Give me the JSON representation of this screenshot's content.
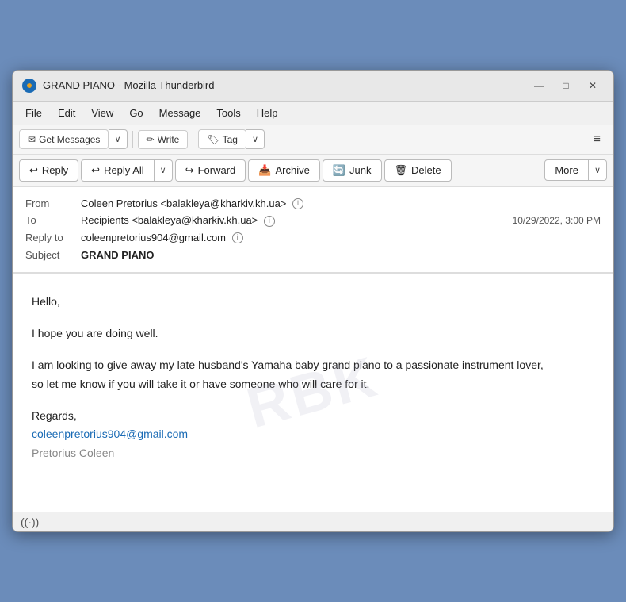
{
  "window": {
    "title": "GRAND PIANO - Mozilla Thunderbird",
    "app_icon": "T",
    "controls": {
      "minimize": "—",
      "maximize": "□",
      "close": "✕"
    }
  },
  "menu_bar": {
    "items": [
      "File",
      "Edit",
      "View",
      "Go",
      "Message",
      "Tools",
      "Help"
    ]
  },
  "toolbar": {
    "get_messages_label": "Get Messages",
    "write_label": "Write",
    "tag_label": "Tag",
    "dropdown_arrow": "∨",
    "hamburger": "≡"
  },
  "action_bar": {
    "reply_label": "Reply",
    "reply_all_label": "Reply All",
    "forward_label": "Forward",
    "archive_label": "Archive",
    "junk_label": "Junk",
    "delete_label": "Delete",
    "more_label": "More",
    "dropdown_arrow": "∨"
  },
  "email_header": {
    "from_label": "From",
    "from_name": "Coleen Pretorius",
    "from_email": "<balakleya@kharkiv.kh.ua>",
    "to_label": "To",
    "to_name": "Recipients",
    "to_email": "<balakleya@kharkiv.kh.ua>",
    "date": "10/29/2022, 3:00 PM",
    "reply_to_label": "Reply to",
    "reply_to_email": "coleenpretorius904@gmail.com",
    "subject_label": "Subject",
    "subject_value": "GRAND PIANO"
  },
  "email_body": {
    "greeting": "Hello,",
    "line1": "I hope you are doing well.",
    "line2": "I am looking to give away my late husband's Yamaha baby grand piano to a passionate instrument lover,",
    "line3": " so let me know if you will take it or have someone who will care for it.",
    "regards": "Regards,",
    "signature_email": "coleenpretorius904@gmail.com",
    "signature_name": "Pretorius Coleen"
  },
  "status_bar": {
    "wifi_icon": "((·))"
  },
  "icons": {
    "reply_icon": "↩",
    "reply_all_icon": "↩↩",
    "forward_icon": "↪",
    "archive_icon": "📥",
    "junk_icon": "🔄",
    "delete_icon": "🗑",
    "mail_icon": "✉",
    "write_icon": "✏",
    "tag_icon": "🏷"
  }
}
